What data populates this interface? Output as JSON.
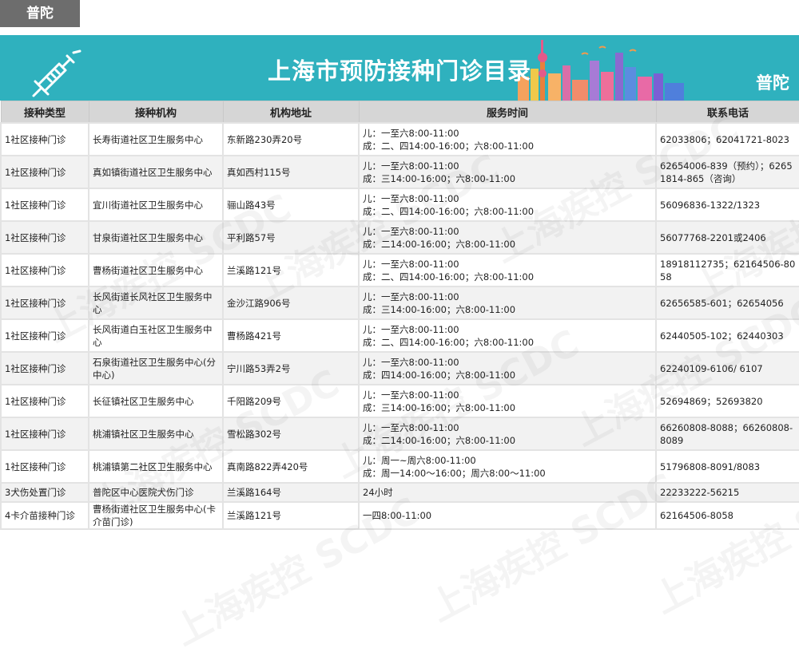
{
  "district_tab": "普陀",
  "banner": {
    "title": "上海市预防接种门诊目录",
    "district": "普陀"
  },
  "watermark": "上海疾控 SCDC",
  "table": {
    "headers": [
      "接种类型",
      "接种机构",
      "机构地址",
      "服务时间",
      "联系电话"
    ],
    "rows": [
      {
        "type": "1社区接种门诊",
        "org": "长寿街道社区卫生服务中心",
        "addr": "东新路230弄20号",
        "time": [
          "儿：一至六8:00-11:00",
          "成：二、四14:00-16:00；六8:00-11:00"
        ],
        "phone": "62033806；62041721-8023"
      },
      {
        "type": "1社区接种门诊",
        "org": "真如镇街道社区卫生服务中心",
        "addr": "真如西村115号",
        "time": [
          "儿：一至六8:00-11:00",
          "成：三14:00-16:00；六8:00-11:00"
        ],
        "phone": "62654006-839（预约）；62651814-865（咨询）"
      },
      {
        "type": "1社区接种门诊",
        "org": "宜川街道社区卫生服务中心",
        "addr": "骊山路43号",
        "time": [
          "儿：一至六8:00-11:00",
          "成：二、四14:00-16:00；六8:00-11:00"
        ],
        "phone": "56096836-1322/1323"
      },
      {
        "type": "1社区接种门诊",
        "org": "甘泉街道社区卫生服务中心",
        "addr": "平利路57号",
        "time": [
          "儿：一至六8:00-11:00",
          "成：二14:00-16:00；六8:00-11:00"
        ],
        "phone": "56077768-2201或2406"
      },
      {
        "type": "1社区接种门诊",
        "org": "曹杨街道社区卫生服务中心",
        "addr": "兰溪路121号",
        "time": [
          "儿：一至六8:00-11:00",
          "成：二、四14:00-16:00；六8:00-11:00"
        ],
        "phone": "18918112735；62164506-8058"
      },
      {
        "type": "1社区接种门诊",
        "org": "长风街道长风社区卫生服务中心",
        "addr": "金沙江路906号",
        "time": [
          "儿：一至六8:00-11:00",
          "成：三14:00-16:00；六8:00-11:00"
        ],
        "phone": "62656585-601；62654056"
      },
      {
        "type": "1社区接种门诊",
        "org": "长风街道白玉社区卫生服务中心",
        "addr": "曹杨路421号",
        "time": [
          "儿：一至六8:00-11:00",
          "成：二、四14:00-16:00；六8:00-11:00"
        ],
        "phone": "62440505-102；62440303"
      },
      {
        "type": "1社区接种门诊",
        "org": "石泉街道社区卫生服务中心(分中心)",
        "addr": "宁川路53弄2号",
        "time": [
          "儿：一至六8:00-11:00",
          "成：四14:00-16:00；六8:00-11:00"
        ],
        "phone": "62240109-6106/ 6107"
      },
      {
        "type": "1社区接种门诊",
        "org": "长征镇社区卫生服务中心",
        "addr": "千阳路209号",
        "time": [
          "儿：一至六8:00-11:00",
          "成：三14:00-16:00；六8:00-11:00"
        ],
        "phone": "52694869；52693820"
      },
      {
        "type": "1社区接种门诊",
        "org": "桃浦镇社区卫生服务中心",
        "addr": "雪松路302号",
        "time": [
          "儿：一至六8:00-11:00",
          "成：二14:00-16:00；六8:00-11:00"
        ],
        "phone": "66260808-8088；66260808-8089"
      },
      {
        "type": "1社区接种门诊",
        "org": "桃浦镇第二社区卫生服务中心",
        "addr": "真南路822弄420号",
        "time": [
          "儿：周一~周六8:00-11:00",
          "成：周一14:00～16:00；周六8:00～11:00"
        ],
        "phone": "51796808-8091/8083"
      },
      {
        "type": "3犬伤处置门诊",
        "org": "普陀区中心医院犬伤门诊",
        "addr": "兰溪路164号",
        "time": [
          "24小时"
        ],
        "phone": "22233222-56215"
      },
      {
        "type": "4卡介苗接种门诊",
        "org": "曹杨街道社区卫生服务中心(卡介苗门诊)",
        "addr": "兰溪路121号",
        "time": [
          "一四8:00-11:00"
        ],
        "phone": "62164506-8058"
      }
    ]
  }
}
